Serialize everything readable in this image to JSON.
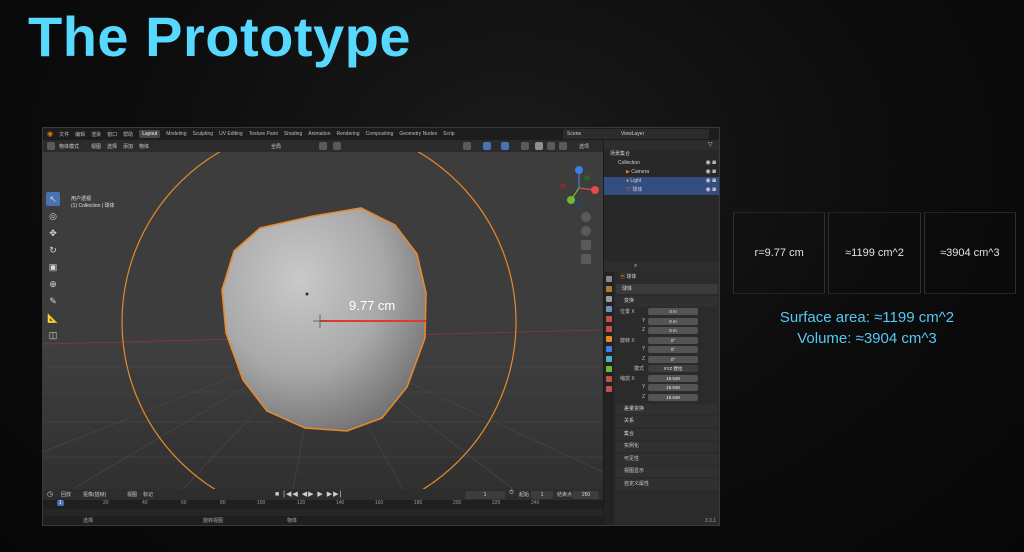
{
  "slide": {
    "title": "The Prototype",
    "title_color": "#56d8ff"
  },
  "blender": {
    "top_menu": [
      "文件",
      "编辑",
      "渲染",
      "窗口",
      "帮助"
    ],
    "workspaces": [
      "Layout",
      "Modeling",
      "Sculpting",
      "UV Editing",
      "Texture Paint",
      "Shading",
      "Animation",
      "Rendering",
      "Compositing",
      "Geometry Nodes",
      "Scrip"
    ],
    "active_workspace": "Layout",
    "scene_name": "Scene",
    "view_layer": "ViewLayer",
    "viewport": {
      "mode": "物体模式",
      "menus": [
        "视图",
        "选择",
        "添加",
        "物体"
      ],
      "transform_orientation": "全局",
      "info_line1": "用户透视",
      "info_line2": "(1) Collection | 球体",
      "measurement_label": "9.77 cm",
      "options_label": "选项"
    },
    "outliner": {
      "root": "场景集合",
      "rows": [
        {
          "label": "Collection",
          "selected": false
        },
        {
          "label": "Camera",
          "selected": false
        },
        {
          "label": "Light",
          "selected": true
        },
        {
          "label": "球体",
          "selected": true
        }
      ]
    },
    "properties": {
      "object_name": "球体",
      "subheader": "球体",
      "section_transform": "变换",
      "rows": [
        {
          "label": "位置 X",
          "value": "0 m"
        },
        {
          "label": "Y",
          "value": "0 m"
        },
        {
          "label": "Z",
          "value": "0 m"
        },
        {
          "label": "旋转 X",
          "value": "0°"
        },
        {
          "label": "Y",
          "value": "0°"
        },
        {
          "label": "Z",
          "value": "0°"
        },
        {
          "label": "模式",
          "value": "XYZ 欧拉"
        },
        {
          "label": "缩放 X",
          "value": "19.548"
        },
        {
          "label": "Y",
          "value": "19.548"
        },
        {
          "label": "Z",
          "value": "19.548"
        }
      ],
      "sections": [
        "差量变换",
        "关系",
        "集合",
        "实例化",
        "可见性",
        "视图显示",
        "自定义属性"
      ]
    },
    "timeline": {
      "menus": [
        "回放",
        "抠像(插帧)",
        "视图",
        "标记"
      ],
      "current_frame": "1",
      "start_label": "起始",
      "start_value": "1",
      "end_label": "结束点",
      "end_value": "250",
      "ruler_marks": [
        "0",
        "20",
        "40",
        "60",
        "80",
        "100",
        "120",
        "140",
        "160",
        "180",
        "200",
        "220",
        "240"
      ],
      "status_left": "选择",
      "status_mid": "旋转视图",
      "status_right": "物体",
      "version": "3.3.1"
    }
  },
  "metrics": {
    "radius": "r=9.77 cm",
    "surface": "≈1199 cm^2",
    "volume": "≈3904 cm^3"
  },
  "formulas": {
    "surface_area": "Surface area: ≈1199 cm^2",
    "volume": "Volume: ≈3904 cm^3"
  },
  "colors": {
    "accent_blue": "#4772b3",
    "selection_orange": "#e8882a",
    "radius_red": "#e23b2b",
    "text_cyan": "#56c8f5"
  }
}
